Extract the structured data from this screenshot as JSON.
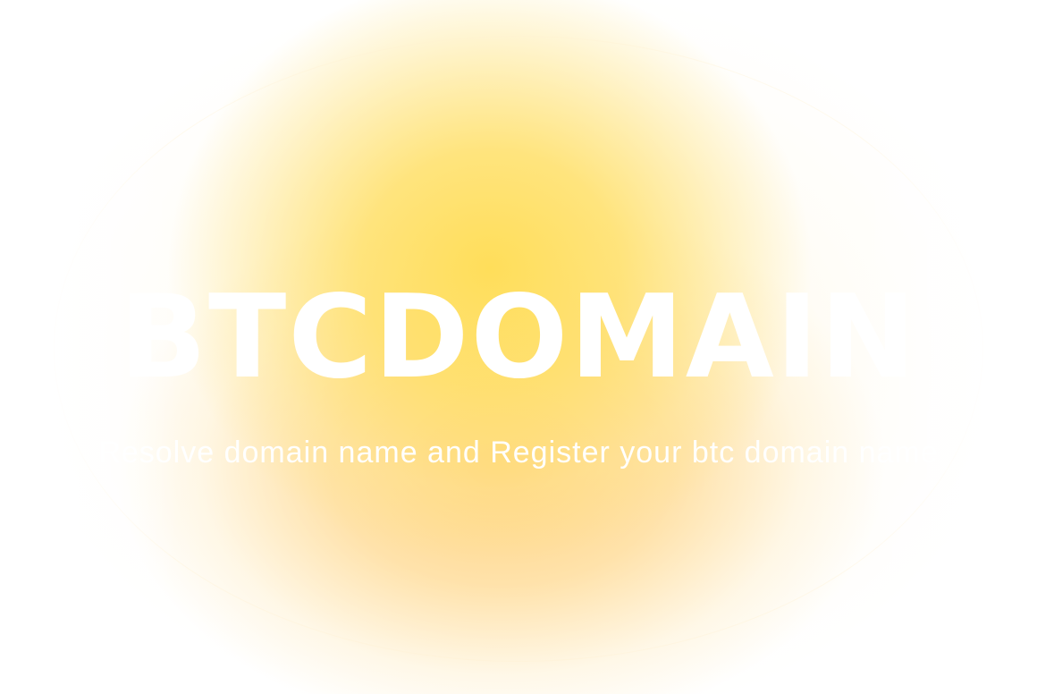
{
  "hero": {
    "brand": "BTCDOMAIN",
    "tagline": "Resolve domain name and Register your btc domain name"
  },
  "colors": {
    "glow_core": "#FFDE5A",
    "glow_lower": "#FFC45A",
    "background": "#FFFFFF",
    "text": "#FFFFFF"
  }
}
